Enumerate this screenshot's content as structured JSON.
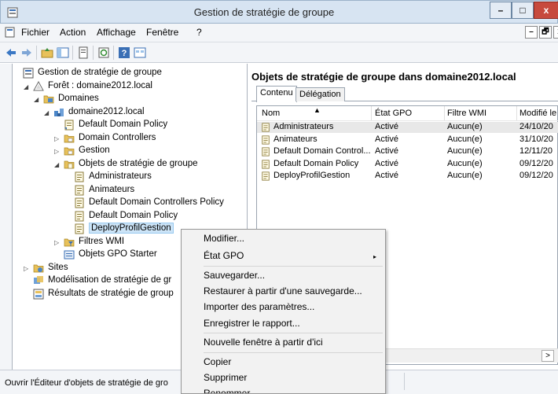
{
  "window": {
    "title": "Gestion de stratégie de groupe"
  },
  "caption_buttons": {
    "minimize": "–",
    "maximize": "□",
    "close": "x"
  },
  "menu": [
    "Fichier",
    "Action",
    "Affichage",
    "Fenêtre",
    "?"
  ],
  "mdi_buttons": [
    "–",
    "🗗",
    "x"
  ],
  "tree": [
    {
      "label": "Gestion de stratégie de groupe",
      "level": 0,
      "expander": "",
      "icon": "gpmc-root-icon"
    },
    {
      "label": "Forêt : domaine2012.local",
      "level": 1,
      "expander": "◢",
      "icon": "forest-icon"
    },
    {
      "label": "Domaines",
      "level": 2,
      "expander": "◢",
      "icon": "domains-folder-icon"
    },
    {
      "label": "domaine2012.local",
      "level": 3,
      "expander": "◢",
      "icon": "domain-icon"
    },
    {
      "label": "Default Domain Policy",
      "level": 4,
      "expander": "",
      "icon": "gpo-link-icon"
    },
    {
      "label": "Domain Controllers",
      "level": 4,
      "expander": "▷",
      "icon": "ou-folder-icon"
    },
    {
      "label": "Gestion",
      "level": 4,
      "expander": "▷",
      "icon": "ou-folder-icon"
    },
    {
      "label": "Objets de stratégie de groupe",
      "level": 4,
      "expander": "◢",
      "icon": "gpo-container-icon"
    },
    {
      "label": "Administrateurs",
      "level": 5,
      "expander": "",
      "icon": "gpo-icon"
    },
    {
      "label": "Animateurs",
      "level": 5,
      "expander": "",
      "icon": "gpo-icon"
    },
    {
      "label": "Default Domain Controllers Policy",
      "level": 5,
      "expander": "",
      "icon": "gpo-icon"
    },
    {
      "label": "Default Domain Policy",
      "level": 5,
      "expander": "",
      "icon": "gpo-icon"
    },
    {
      "label": "DeployProfilGestion",
      "level": 5,
      "expander": "",
      "icon": "gpo-icon",
      "selected": true
    },
    {
      "label": "Filtres WMI",
      "level": 4,
      "expander": "▷",
      "icon": "wmi-folder-icon"
    },
    {
      "label": "Objets GPO Starter",
      "level": 4,
      "expander": "",
      "icon": "starter-gpo-icon"
    },
    {
      "label": "Sites",
      "level": 1,
      "expander": "▷",
      "icon": "sites-icon"
    },
    {
      "label": "Modélisation de stratégie de gr",
      "level": 1,
      "expander": "",
      "icon": "modeling-icon"
    },
    {
      "label": "Résultats de stratégie de group",
      "level": 1,
      "expander": "",
      "icon": "results-icon"
    }
  ],
  "right_pane": {
    "title": "Objets de stratégie de groupe dans domaine2012.local",
    "tabs": [
      "Contenu",
      "Délégation"
    ],
    "columns": [
      "Nom",
      "État GPO",
      "Filtre WMI",
      "Modifié le"
    ],
    "sort_indicator": "▲",
    "rows": [
      {
        "name": "Administrateurs",
        "state": "Activé",
        "wmi": "Aucun(e)",
        "modified": "24/10/20"
      },
      {
        "name": "Animateurs",
        "state": "Activé",
        "wmi": "Aucun(e)",
        "modified": "31/10/20"
      },
      {
        "name": "Default Domain Control...",
        "state": "Activé",
        "wmi": "Aucun(e)",
        "modified": "12/11/20"
      },
      {
        "name": "Default Domain Policy",
        "state": "Activé",
        "wmi": "Aucun(e)",
        "modified": "09/12/20"
      },
      {
        "name": "DeployProfilGestion",
        "state": "Activé",
        "wmi": "Aucun(e)",
        "modified": "09/12/20"
      }
    ],
    "scroll_right": ">"
  },
  "status": {
    "text": "Ouvrir l'Éditeur d'objets de stratégie de gro"
  },
  "context_menu": {
    "items": [
      {
        "label": "Modifier...",
        "submenu": false
      },
      {
        "label": "État GPO",
        "submenu": true
      },
      {
        "label": "Sauvegarder...",
        "submenu": false
      },
      {
        "label": "Restaurer à partir d'une sauvegarde...",
        "submenu": false
      },
      {
        "label": "Importer des paramètres...",
        "submenu": false
      },
      {
        "label": "Enregistrer le rapport...",
        "submenu": false
      },
      {
        "label": "Nouvelle fenêtre à partir d'ici",
        "submenu": false
      },
      {
        "label": "Copier",
        "submenu": false
      },
      {
        "label": "Supprimer",
        "submenu": false
      },
      {
        "label": "Renommer",
        "submenu": false
      }
    ],
    "submenu_arrow": "▸"
  },
  "colors": {
    "titlebar": "#d7e4f2",
    "selection": "#cce4f7",
    "close": "#c74a3d"
  }
}
